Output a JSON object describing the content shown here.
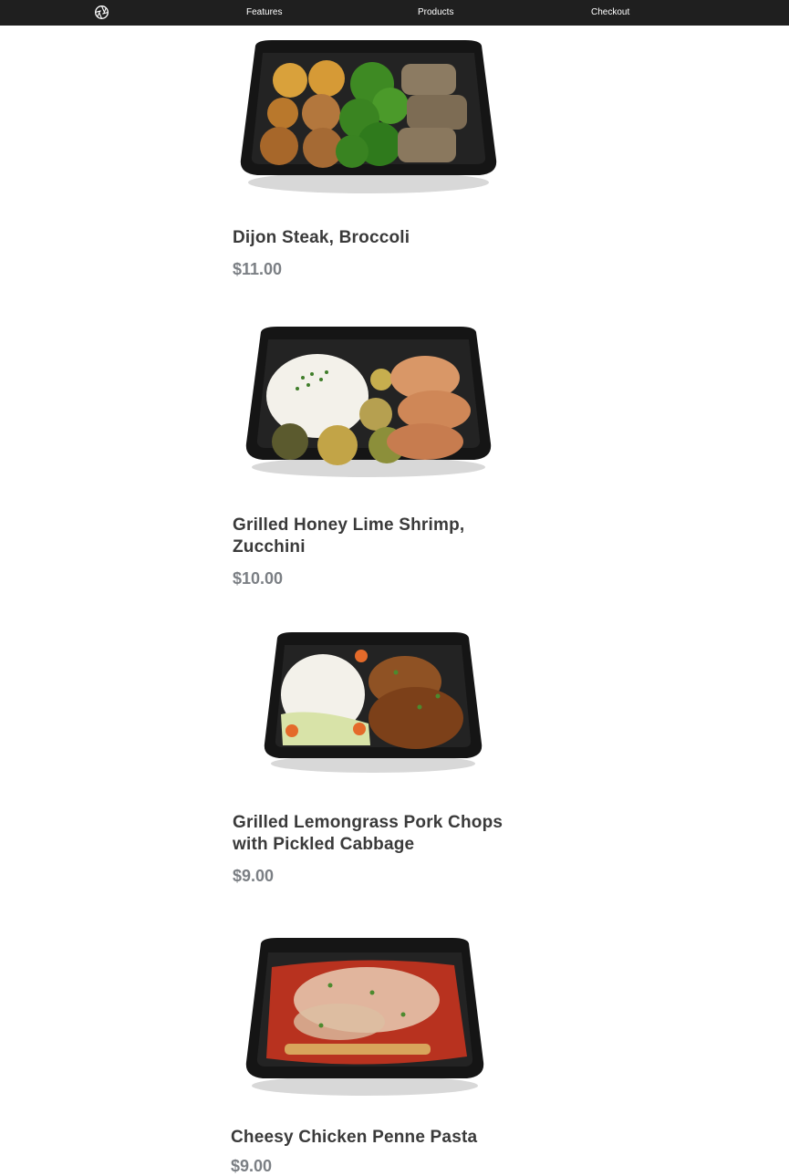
{
  "nav": {
    "logo_icon": "aperture-logo-icon",
    "links": [
      "Features",
      "Products",
      "Checkout"
    ]
  },
  "products": [
    {
      "name": "Dijon Steak, Broccoli",
      "price": "$11.00",
      "image_icon": "meal-container-steak-broccoli-icon"
    },
    {
      "name": "Grilled Honey Lime Shrimp, Zucchini",
      "price": "$10.00",
      "image_icon": "meal-container-shrimp-zucchini-icon"
    },
    {
      "name": "Grilled Lemongrass Pork Chops with Pickled Cabbage",
      "price": "$9.00",
      "image_icon": "meal-container-pork-chops-icon"
    },
    {
      "name": "Cheesy Chicken Penne Pasta",
      "price": "$9.00",
      "image_icon": "meal-container-penne-pasta-icon"
    }
  ],
  "colors": {
    "nav_bg": "#1f1f1f",
    "title": "#3a3a3a",
    "price": "#7b7f84",
    "container": "#151515"
  }
}
